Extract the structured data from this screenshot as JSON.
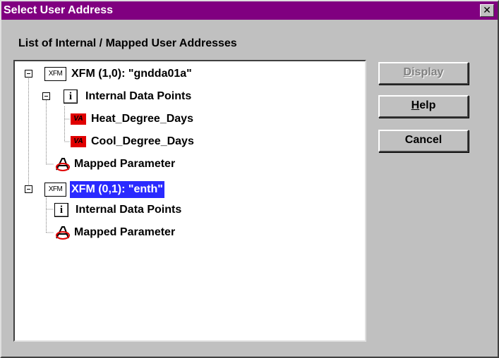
{
  "window": {
    "title": "Select User Address",
    "close_glyph": "✕"
  },
  "list_caption": "List of Internal / Mapped User Addresses",
  "tree": {
    "nodes": [
      {
        "icon": "XFM",
        "label": "XFM (1,0): \"gndda01a\"",
        "level": 0,
        "expanded": true,
        "selected": false
      },
      {
        "icon": "i",
        "label": "Internal Data Points",
        "level": 1,
        "expanded": true,
        "selected": false
      },
      {
        "icon": "VA",
        "label": "Heat_Degree_Days",
        "level": 2,
        "selected": false
      },
      {
        "icon": "VA",
        "label": "Cool_Degree_Days",
        "level": 2,
        "selected": false
      },
      {
        "icon": "mapped-parameter-icon",
        "label": "Mapped Parameter",
        "level": 1,
        "selected": false
      },
      {
        "icon": "XFM",
        "label": "XFM (0,1): \"enth\"",
        "level": 0,
        "expanded": true,
        "selected": true
      },
      {
        "icon": "i",
        "label": "Internal Data Points",
        "level": 1,
        "selected": false
      },
      {
        "icon": "mapped-parameter-icon",
        "label": "Mapped Parameter",
        "level": 1,
        "selected": false
      }
    ]
  },
  "buttons": {
    "display": {
      "first": "D",
      "rest": "isplay",
      "enabled": false
    },
    "help": {
      "first": "H",
      "rest": "elp",
      "enabled": true
    },
    "cancel": {
      "label": "Cancel",
      "enabled": true
    }
  },
  "colors": {
    "title_bar": "#800080",
    "selection": "#2a2aff",
    "va_icon": "#e00000"
  }
}
